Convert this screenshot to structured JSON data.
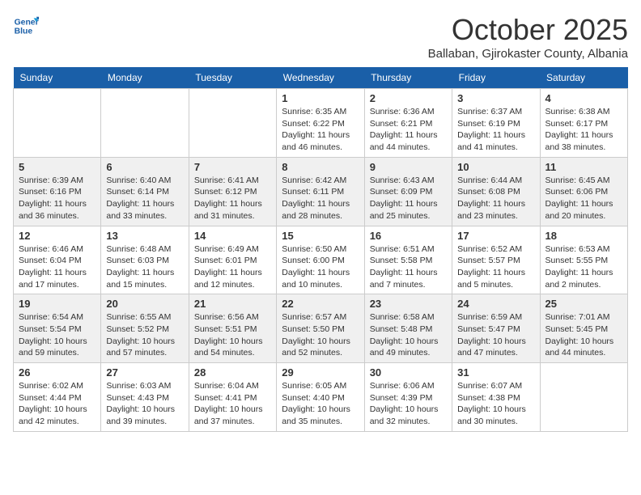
{
  "logo": {
    "line1": "General",
    "line2": "Blue"
  },
  "title": "October 2025",
  "subtitle": "Ballaban, Gjirokaster County, Albania",
  "weekdays": [
    "Sunday",
    "Monday",
    "Tuesday",
    "Wednesday",
    "Thursday",
    "Friday",
    "Saturday"
  ],
  "weeks": [
    [
      {
        "day": "",
        "info": ""
      },
      {
        "day": "",
        "info": ""
      },
      {
        "day": "",
        "info": ""
      },
      {
        "day": "1",
        "info": "Sunrise: 6:35 AM\nSunset: 6:22 PM\nDaylight: 11 hours\nand 46 minutes."
      },
      {
        "day": "2",
        "info": "Sunrise: 6:36 AM\nSunset: 6:21 PM\nDaylight: 11 hours\nand 44 minutes."
      },
      {
        "day": "3",
        "info": "Sunrise: 6:37 AM\nSunset: 6:19 PM\nDaylight: 11 hours\nand 41 minutes."
      },
      {
        "day": "4",
        "info": "Sunrise: 6:38 AM\nSunset: 6:17 PM\nDaylight: 11 hours\nand 38 minutes."
      }
    ],
    [
      {
        "day": "5",
        "info": "Sunrise: 6:39 AM\nSunset: 6:16 PM\nDaylight: 11 hours\nand 36 minutes."
      },
      {
        "day": "6",
        "info": "Sunrise: 6:40 AM\nSunset: 6:14 PM\nDaylight: 11 hours\nand 33 minutes."
      },
      {
        "day": "7",
        "info": "Sunrise: 6:41 AM\nSunset: 6:12 PM\nDaylight: 11 hours\nand 31 minutes."
      },
      {
        "day": "8",
        "info": "Sunrise: 6:42 AM\nSunset: 6:11 PM\nDaylight: 11 hours\nand 28 minutes."
      },
      {
        "day": "9",
        "info": "Sunrise: 6:43 AM\nSunset: 6:09 PM\nDaylight: 11 hours\nand 25 minutes."
      },
      {
        "day": "10",
        "info": "Sunrise: 6:44 AM\nSunset: 6:08 PM\nDaylight: 11 hours\nand 23 minutes."
      },
      {
        "day": "11",
        "info": "Sunrise: 6:45 AM\nSunset: 6:06 PM\nDaylight: 11 hours\nand 20 minutes."
      }
    ],
    [
      {
        "day": "12",
        "info": "Sunrise: 6:46 AM\nSunset: 6:04 PM\nDaylight: 11 hours\nand 17 minutes."
      },
      {
        "day": "13",
        "info": "Sunrise: 6:48 AM\nSunset: 6:03 PM\nDaylight: 11 hours\nand 15 minutes."
      },
      {
        "day": "14",
        "info": "Sunrise: 6:49 AM\nSunset: 6:01 PM\nDaylight: 11 hours\nand 12 minutes."
      },
      {
        "day": "15",
        "info": "Sunrise: 6:50 AM\nSunset: 6:00 PM\nDaylight: 11 hours\nand 10 minutes."
      },
      {
        "day": "16",
        "info": "Sunrise: 6:51 AM\nSunset: 5:58 PM\nDaylight: 11 hours\nand 7 minutes."
      },
      {
        "day": "17",
        "info": "Sunrise: 6:52 AM\nSunset: 5:57 PM\nDaylight: 11 hours\nand 5 minutes."
      },
      {
        "day": "18",
        "info": "Sunrise: 6:53 AM\nSunset: 5:55 PM\nDaylight: 11 hours\nand 2 minutes."
      }
    ],
    [
      {
        "day": "19",
        "info": "Sunrise: 6:54 AM\nSunset: 5:54 PM\nDaylight: 10 hours\nand 59 minutes."
      },
      {
        "day": "20",
        "info": "Sunrise: 6:55 AM\nSunset: 5:52 PM\nDaylight: 10 hours\nand 57 minutes."
      },
      {
        "day": "21",
        "info": "Sunrise: 6:56 AM\nSunset: 5:51 PM\nDaylight: 10 hours\nand 54 minutes."
      },
      {
        "day": "22",
        "info": "Sunrise: 6:57 AM\nSunset: 5:50 PM\nDaylight: 10 hours\nand 52 minutes."
      },
      {
        "day": "23",
        "info": "Sunrise: 6:58 AM\nSunset: 5:48 PM\nDaylight: 10 hours\nand 49 minutes."
      },
      {
        "day": "24",
        "info": "Sunrise: 6:59 AM\nSunset: 5:47 PM\nDaylight: 10 hours\nand 47 minutes."
      },
      {
        "day": "25",
        "info": "Sunrise: 7:01 AM\nSunset: 5:45 PM\nDaylight: 10 hours\nand 44 minutes."
      }
    ],
    [
      {
        "day": "26",
        "info": "Sunrise: 6:02 AM\nSunset: 4:44 PM\nDaylight: 10 hours\nand 42 minutes."
      },
      {
        "day": "27",
        "info": "Sunrise: 6:03 AM\nSunset: 4:43 PM\nDaylight: 10 hours\nand 39 minutes."
      },
      {
        "day": "28",
        "info": "Sunrise: 6:04 AM\nSunset: 4:41 PM\nDaylight: 10 hours\nand 37 minutes."
      },
      {
        "day": "29",
        "info": "Sunrise: 6:05 AM\nSunset: 4:40 PM\nDaylight: 10 hours\nand 35 minutes."
      },
      {
        "day": "30",
        "info": "Sunrise: 6:06 AM\nSunset: 4:39 PM\nDaylight: 10 hours\nand 32 minutes."
      },
      {
        "day": "31",
        "info": "Sunrise: 6:07 AM\nSunset: 4:38 PM\nDaylight: 10 hours\nand 30 minutes."
      },
      {
        "day": "",
        "info": ""
      }
    ]
  ]
}
